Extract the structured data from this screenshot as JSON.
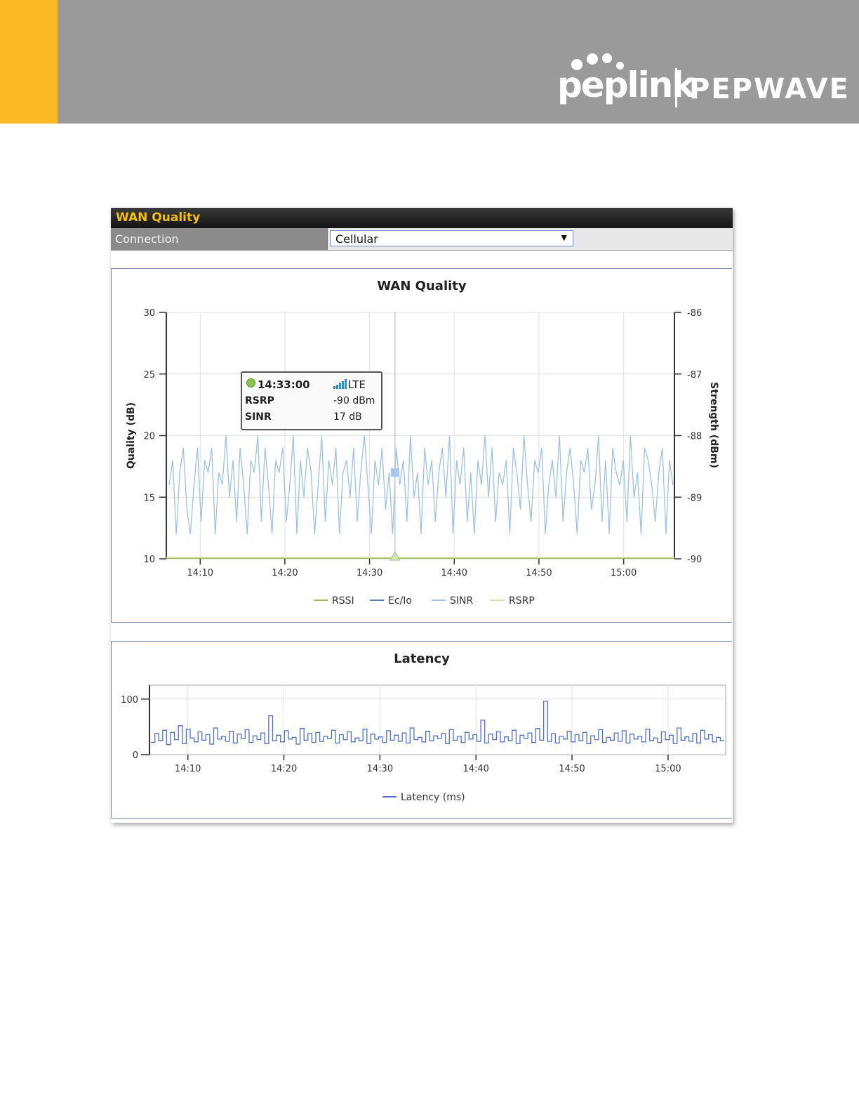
{
  "brand": {
    "logo_primary": "peplink",
    "logo_secondary": "PEPWAVE",
    "banner_color": "#9a9a9a",
    "accent_color": "#fdb825"
  },
  "panel": {
    "title": "WAN Quality",
    "connection_label": "Connection",
    "connection_value": "Cellular",
    "dropdown_icon": "triangle-down"
  },
  "tooltip": {
    "time": "14:33:00",
    "network": "LTE",
    "rows": [
      {
        "label": "RSRP",
        "value": "-90 dBm"
      },
      {
        "label": "SINR",
        "value": "17 dB"
      }
    ]
  },
  "chart_data": [
    {
      "type": "line",
      "title": "WAN Quality",
      "ylabel": "Quality (dB)",
      "y2label": "Strength (dBm)",
      "ylim": [
        10,
        30
      ],
      "y2lim": [
        -90,
        -86
      ],
      "yticks": [
        10,
        15,
        20,
        25,
        30
      ],
      "y2ticks": [
        -90,
        -89,
        -88,
        -87,
        -86
      ],
      "xticks": [
        "14:10",
        "14:20",
        "14:30",
        "14:40",
        "14:50",
        "15:00"
      ],
      "x_start": "14:06",
      "x_end": "15:06",
      "grid": true,
      "legend_position": "bottom",
      "series": [
        {
          "name": "RSSI",
          "color": "#9bbb59",
          "values": [
            10,
            10,
            10,
            10,
            10,
            10
          ]
        },
        {
          "name": "Ec/Io",
          "color": "#4f81bd",
          "values": []
        },
        {
          "name": "SINR",
          "color": "#9cc2e5",
          "values": [
            16,
            18,
            12,
            17,
            19,
            14,
            12,
            16,
            19,
            13,
            18,
            17,
            19,
            12,
            17,
            16,
            20,
            15,
            18,
            13,
            19,
            16,
            12,
            18,
            17,
            20,
            13,
            19,
            16,
            12,
            18,
            17,
            19,
            13,
            16,
            20,
            12,
            18,
            15,
            19,
            17,
            12,
            16,
            20,
            13,
            18,
            16,
            19,
            12,
            17,
            18,
            15,
            19,
            13,
            17,
            20,
            16,
            12,
            18,
            16,
            19,
            14,
            17,
            12,
            19,
            16,
            18,
            13,
            20,
            15,
            17,
            12,
            19,
            16,
            18,
            13,
            17,
            19,
            15,
            20,
            12,
            18,
            16,
            19,
            13,
            17,
            12,
            18,
            16,
            20,
            15,
            19,
            13,
            17,
            16,
            18,
            12,
            19,
            17,
            14,
            20,
            16,
            13,
            18,
            17,
            19,
            12,
            16,
            18,
            15,
            20,
            13,
            17,
            19,
            16,
            12,
            18,
            17,
            19,
            14,
            16,
            20,
            13,
            18,
            12,
            19,
            17,
            16,
            18,
            13,
            20,
            15,
            17,
            12,
            19,
            18,
            16,
            13,
            17,
            19,
            12,
            18,
            16
          ],
          "highlight": {
            "time": "14:33:00",
            "value": 17
          }
        },
        {
          "name": "RSRP",
          "color": "#d9e2a0",
          "values": [
            -90,
            -90,
            -90,
            -90,
            -90,
            -90
          ],
          "highlight": {
            "time": "14:33:00",
            "value": -90
          }
        }
      ]
    },
    {
      "type": "line",
      "title": "Latency",
      "ylim": [
        0,
        125
      ],
      "yticks": [
        0,
        100
      ],
      "xticks": [
        "14:10",
        "14:20",
        "14:30",
        "14:40",
        "14:50",
        "15:00"
      ],
      "x_start": "14:06",
      "x_end": "15:06",
      "grid": true,
      "legend_position": "bottom",
      "series": [
        {
          "name": "Latency (ms)",
          "color": "#4f6fcf",
          "values": [
            22,
            38,
            25,
            44,
            18,
            40,
            27,
            52,
            20,
            46,
            30,
            23,
            41,
            26,
            36,
            19,
            48,
            28,
            33,
            24,
            42,
            21,
            37,
            29,
            45,
            22,
            34,
            27,
            39,
            20,
            70,
            25,
            35,
            23,
            43,
            28,
            31,
            19,
            47,
            26,
            38,
            22,
            40,
            24,
            33,
            29,
            44,
            21,
            36,
            27,
            41,
            23,
            30,
            25,
            46,
            20,
            37,
            28,
            32,
            22,
            43,
            26,
            35,
            24,
            39,
            21,
            48,
            27,
            31,
            23,
            42,
            25,
            34,
            29,
            38,
            20,
            45,
            26,
            33,
            22,
            40,
            28,
            36,
            24,
            62,
            21,
            37,
            27,
            41,
            23,
            32,
            25,
            44,
            20,
            35,
            29,
            39,
            22,
            47,
            26,
            96,
            24,
            38,
            21,
            33,
            28,
            42,
            23,
            36,
            25,
            40,
            20,
            34,
            27,
            45,
            22,
            31,
            26,
            39,
            24,
            43,
            21,
            37,
            28,
            33,
            23,
            46,
            25,
            30,
            22,
            41,
            27,
            35,
            20,
            48,
            26,
            32,
            24,
            38,
            21,
            44,
            28,
            36,
            23,
            31,
            25
          ]
        }
      ]
    }
  ]
}
